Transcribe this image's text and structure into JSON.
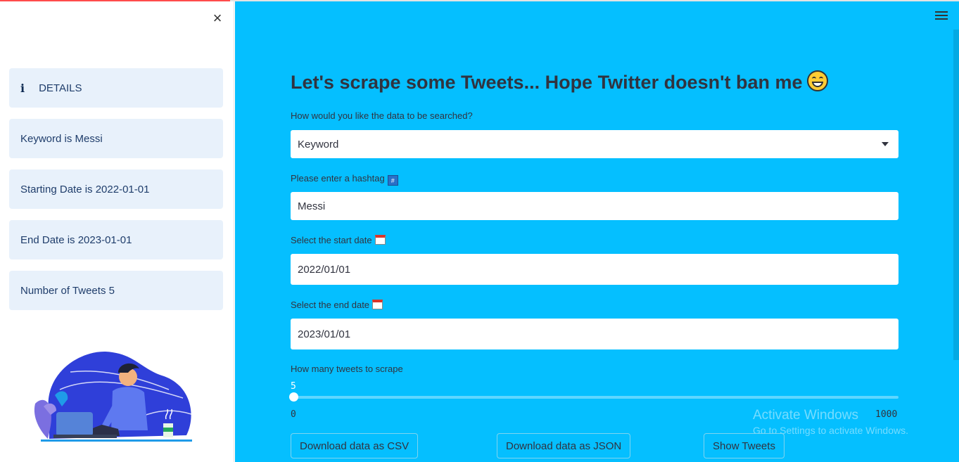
{
  "sidebar": {
    "details_icon": "i",
    "details_label": "DETAILS",
    "cards": [
      "Keyword is Messi",
      "Starting Date is 2022-01-01",
      "End Date is 2023-01-01",
      "Number of Tweets 5"
    ],
    "close_icon": "×"
  },
  "main": {
    "title": "Let's scrape some Tweets... Hope Twitter doesn't ban me",
    "search_label": "How would you like the data to be searched?",
    "search_value": "Keyword",
    "hashtag_label": "Please enter a hashtag",
    "hashtag_badge": "#",
    "hashtag_value": "Messi",
    "start_label": "Select the start date",
    "start_value": "2022/01/01",
    "end_label": "Select the end date",
    "end_value": "2023/01/01",
    "tweets_label": "How many tweets to scrape",
    "slider": {
      "value": "5",
      "min": "0",
      "max": "1000"
    },
    "buttons": {
      "csv": "Download data as CSV",
      "json": "Download data as JSON",
      "show": "Show Tweets"
    }
  },
  "watermark": {
    "line1": "Activate Windows",
    "line2": "Go to Settings to activate Windows."
  },
  "colors": {
    "main_bg": "#05bfff",
    "card_bg": "#e8f1fb",
    "accent": "#ff4b4b"
  }
}
